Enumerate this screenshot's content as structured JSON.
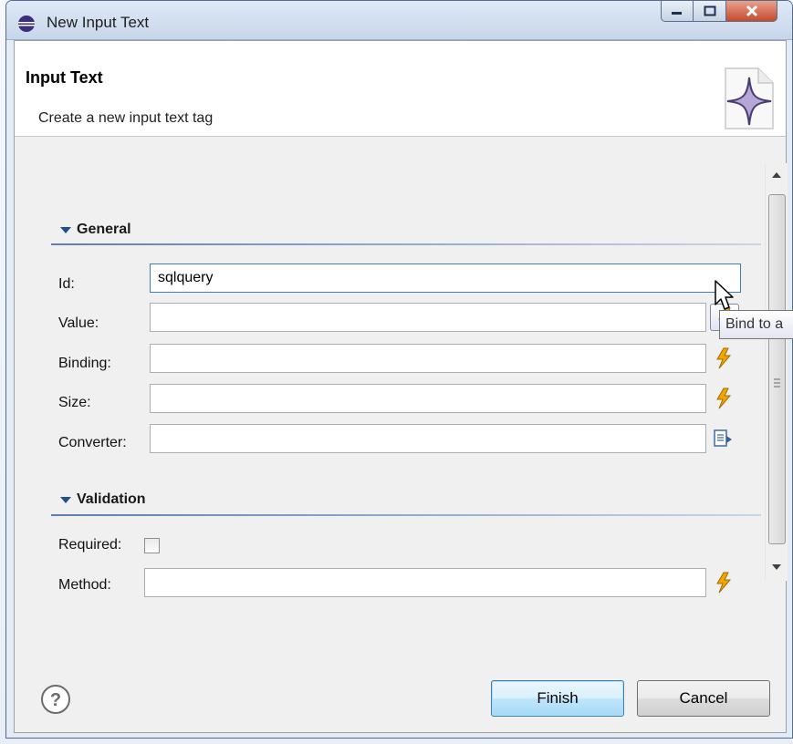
{
  "window": {
    "title": "New Input Text",
    "controls": [
      "minimize",
      "maximize",
      "close"
    ]
  },
  "header": {
    "title": "Input Text",
    "description": "Create a new input text tag",
    "graphic_icon": "star-document-icon"
  },
  "sections": {
    "general": {
      "title": "General",
      "fields": {
        "id": {
          "label": "Id:",
          "value": "sqlquery"
        },
        "value": {
          "label": "Value:",
          "value": ""
        },
        "binding": {
          "label": "Binding:",
          "value": ""
        },
        "size": {
          "label": "Size:",
          "value": ""
        },
        "converter": {
          "label": "Converter:",
          "value": ""
        }
      }
    },
    "validation": {
      "title": "Validation",
      "required": {
        "label": "Required:",
        "checked": false
      },
      "method": {
        "label": "Method:",
        "value": ""
      }
    }
  },
  "tooltip": {
    "text": "Bind to a"
  },
  "buttons": {
    "finish": "Finish",
    "cancel": "Cancel",
    "help_icon": "help-icon"
  },
  "colors": {
    "section_title_rule": "#5b7fb0",
    "bolt_icon": "#f0a800",
    "default_button_border": "#3c7fb1"
  }
}
